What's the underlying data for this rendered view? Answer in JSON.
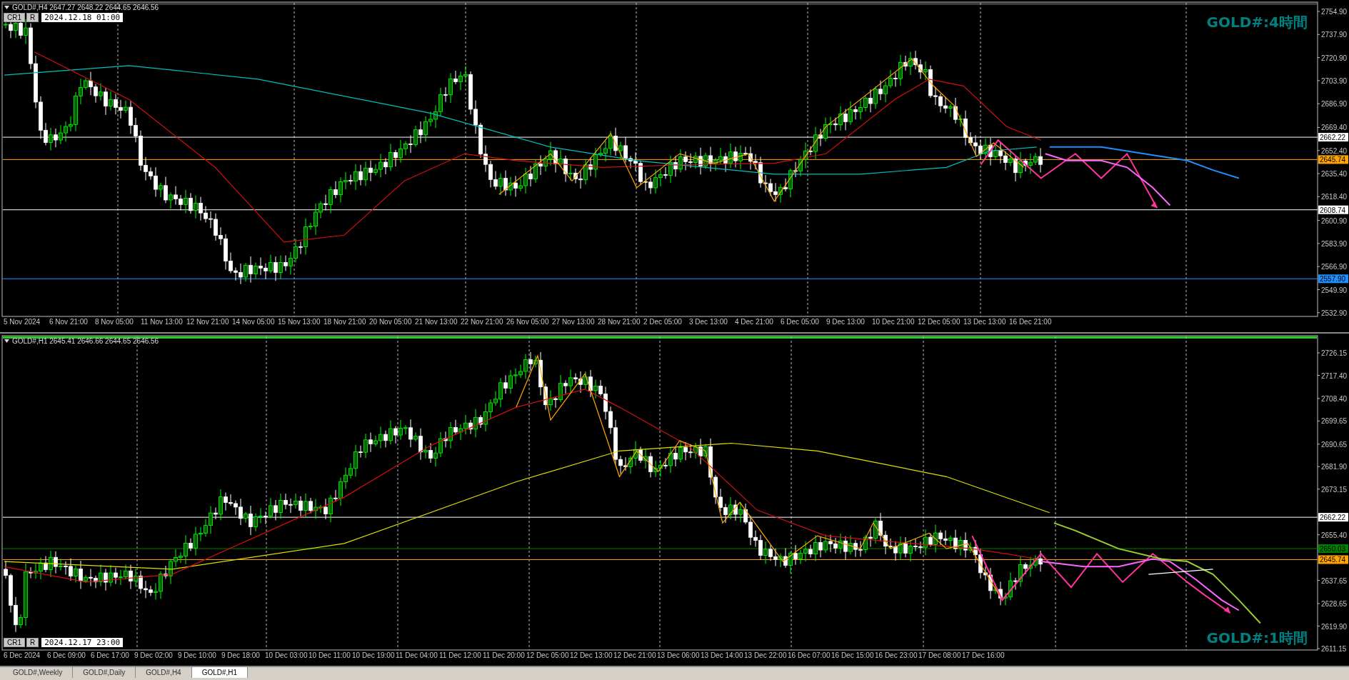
{
  "charts": [
    {
      "kind": "h4",
      "header": "GOLD#,H4  2647.27 2648.22 2644.65 2646.56",
      "controls": {
        "buttons": [
          "CR1",
          "R"
        ],
        "date": "2024.12.18 01:00"
      },
      "title": "GOLD#:4時間",
      "active": false,
      "price_ticks": [
        "2754.90",
        "2737.90",
        "2720.90",
        "2703.90",
        "2686.90",
        "2669.40",
        "2652.40",
        "2635.40",
        "2618.40",
        "2600.90",
        "2583.90",
        "2566.90",
        "2549.90",
        "2532.90"
      ],
      "price_lines": [
        {
          "label": "2662.22",
          "color": "#ffffff"
        },
        {
          "label": "2645.74",
          "color": "#ffa500"
        },
        {
          "label": "2608.74",
          "color": "#ffffff"
        },
        {
          "label": "2557.90",
          "color": "#1e90ff"
        }
      ],
      "time_labels": [
        "5 Nov 2024",
        "6 Nov 21:00",
        "8 Nov 05:00",
        "11 Nov 13:00",
        "12 Nov 21:00",
        "14 Nov 05:00",
        "15 Nov 13:00",
        "18 Nov 21:00",
        "20 Nov 05:00",
        "21 Nov 13:00",
        "22 Nov 21:00",
        "26 Nov 05:00",
        "27 Nov 13:00",
        "28 Nov 21:00",
        "2 Dec 05:00",
        "3 Dec 13:00",
        "4 Dec 21:00",
        "6 Dec 05:00",
        "9 Dec 13:00",
        "10 Dec 21:00",
        "12 Dec 05:00",
        "13 Dec 13:00",
        "16 Dec 21:00"
      ]
    },
    {
      "kind": "h1",
      "header": "GOLD#,H1  2645.41 2646.66 2644.65 2646.56",
      "controls": {
        "buttons": [
          "CR1",
          "R"
        ],
        "date": "2024.12.17 23:00"
      },
      "title": "GOLD#:1時間",
      "active": true,
      "price_ticks": [
        "2726.15",
        "2717.40",
        "2708.40",
        "2699.65",
        "2690.65",
        "2681.90",
        "2673.15",
        "2655.40",
        "2637.65",
        "2628.65",
        "2619.90",
        "2611.15"
      ],
      "price_lines": [
        {
          "label": "2662.22",
          "color": "#ffffff"
        },
        {
          "label": "2650.03",
          "color": "#008000"
        },
        {
          "label": "2645.74",
          "color": "#ffa500"
        }
      ],
      "time_labels": [
        "6 Dec 2024",
        "6 Dec 09:00",
        "6 Dec 17:00",
        "9 Dec 02:00",
        "9 Dec 10:00",
        "9 Dec 18:00",
        "10 Dec 03:00",
        "10 Dec 11:00",
        "10 Dec 19:00",
        "11 Dec 04:00",
        "11 Dec 12:00",
        "11 Dec 20:00",
        "12 Dec 05:00",
        "12 Dec 13:00",
        "12 Dec 21:00",
        "13 Dec 06:00",
        "13 Dec 14:00",
        "13 Dec 22:00",
        "16 Dec 07:00",
        "16 Dec 15:00",
        "16 Dec 23:00",
        "17 Dec 08:00",
        "17 Dec 16:00"
      ]
    }
  ],
  "tabs": [
    {
      "label": "GOLD#,Weekly",
      "selected": false
    },
    {
      "label": "GOLD#,Daily",
      "selected": false
    },
    {
      "label": "GOLD#,H4",
      "selected": false
    },
    {
      "label": "GOLD#,H1",
      "selected": true
    }
  ]
}
